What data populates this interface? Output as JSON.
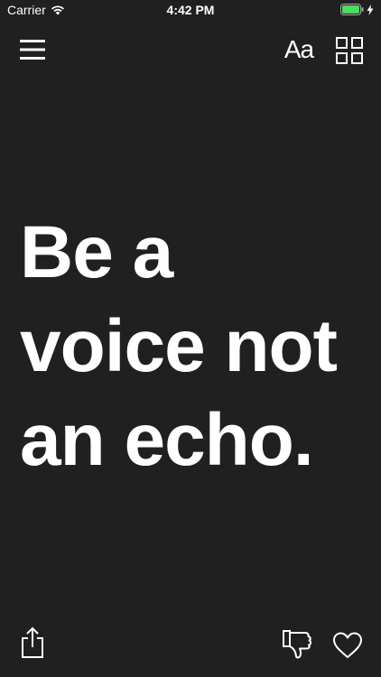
{
  "status_bar": {
    "carrier": "Carrier",
    "time": "4:42 PM",
    "wifi_icon": "wifi-icon",
    "battery_icon": "battery-icon",
    "charging_icon": "bolt-icon",
    "battery_color": "#4cd964"
  },
  "toolbar": {
    "menu_icon": "hamburger-menu-icon",
    "font_label": "Aa",
    "grid_icon": "grid-icon"
  },
  "quote": {
    "text": "Be a\nvoice not\nan echo."
  },
  "bottom_bar": {
    "share_icon": "share-icon",
    "dislike_icon": "thumbs-down-icon",
    "like_icon": "heart-icon"
  },
  "colors": {
    "background": "#202020",
    "foreground": "#ffffff"
  }
}
